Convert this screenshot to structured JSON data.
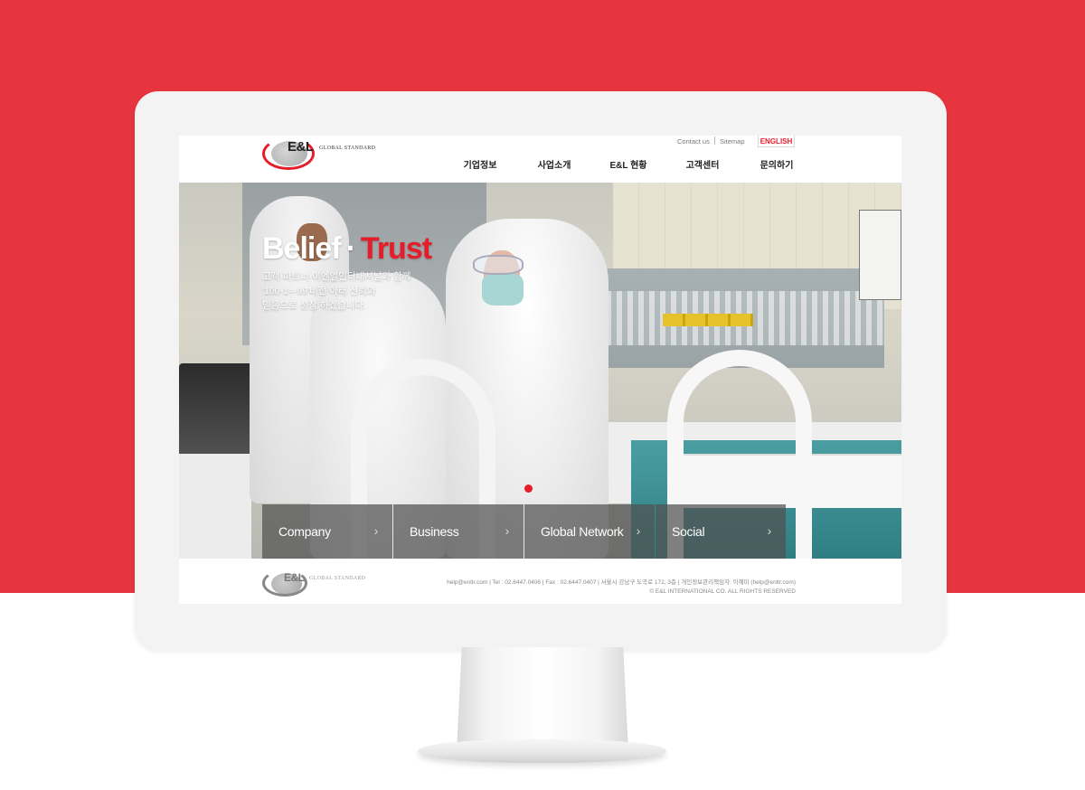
{
  "colors": {
    "brand_red": "#e7353f",
    "accent_red": "#e51d2a",
    "footer_text": "#888888"
  },
  "header": {
    "logo_text": "E&L",
    "logo_tagline": "GLOBAL STANDARD",
    "utility": {
      "contact": "Contact us",
      "sitemap": "Sitemap",
      "language": "ENGLISH"
    },
    "nav": [
      {
        "label": "기업정보"
      },
      {
        "label": "사업소개"
      },
      {
        "label": "E&L 현황"
      },
      {
        "label": "고객센터"
      },
      {
        "label": "문의하기"
      }
    ]
  },
  "hero": {
    "title_part1": "Belief",
    "title_sep": "·",
    "title_part2": "Trust",
    "desc_line1": "고객·파트너·이엔엘인터내셔널과 함께",
    "desc_line2": "'100-1=-99'비전 아래 신뢰와",
    "desc_line3": "믿음으로 성장 하겠습니다."
  },
  "quick_links": [
    {
      "label": "Company",
      "icon": "chevron-right-icon"
    },
    {
      "label": "Business",
      "icon": "chevron-right-icon"
    },
    {
      "label": "Global Network",
      "icon": "chevron-right-icon"
    },
    {
      "label": "Social",
      "icon": "chevron-right-icon"
    }
  ],
  "footer": {
    "logo_text": "E&L",
    "logo_tagline": "GLOBAL STANDARD",
    "info_line1": "help@enltr.com | Tel : 02.6447.0406 | Fax : 02.6447.0407 | 서울시 강남구 도곡로 172, 3층 | 개인정보관리책임자: 이혜미 (help@enltr.com)",
    "copyright": "© E&L INTERNATIONAL CO. ALL RIGHTS RESERVED"
  }
}
